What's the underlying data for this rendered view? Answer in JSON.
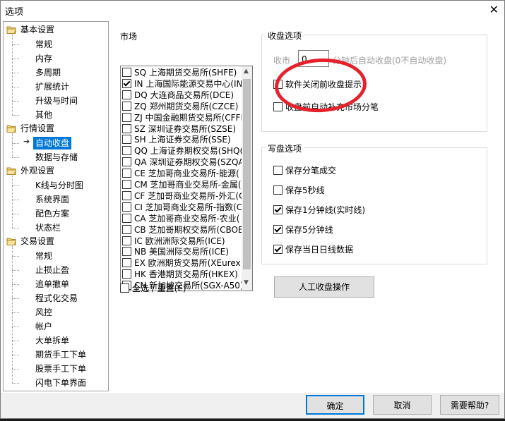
{
  "window": {
    "title": "选项",
    "close_glyph": "✕"
  },
  "tree": {
    "groups": [
      {
        "label": "基本设置",
        "items": [
          "常规",
          "内存",
          "多周期",
          "扩展统计",
          "升级与时间",
          "其他"
        ]
      },
      {
        "label": "行情设置",
        "items": [
          "自动收盘",
          "数据与存储"
        ],
        "selected": "自动收盘"
      },
      {
        "label": "外观设置",
        "items": [
          "K线与分时图",
          "系统界面",
          "配色方案",
          "状态栏"
        ]
      },
      {
        "label": "交易设置",
        "items": [
          "常规",
          "止损止盈",
          "追单撤单",
          "程式化交易",
          "风控",
          "帐户",
          "大单拆单",
          "期货手工下单",
          "股票手工下单",
          "闪电下单界面"
        ]
      }
    ]
  },
  "market": {
    "label": "市场",
    "items": [
      {
        "text": "SQ 上海期货交易所(SHFE)",
        "checked": false
      },
      {
        "text": "IN 上海国际能源交易中心(IN",
        "checked": true
      },
      {
        "text": "DQ 大连商品交易所(DCE)",
        "checked": false
      },
      {
        "text": "ZQ 郑州期货交易所(CZCE)",
        "checked": false
      },
      {
        "text": "ZJ 中国金融期货交易所(CFFE",
        "checked": false
      },
      {
        "text": "SZ 深圳证券交易所(SZSE)",
        "checked": false
      },
      {
        "text": "SH 上海证券交易所(SSE)",
        "checked": false
      },
      {
        "text": "QQ 上海证券期权交易(SHQ(",
        "checked": false
      },
      {
        "text": "QA 深圳证券期权交易(SZQA",
        "checked": false
      },
      {
        "text": "CE 芝加哥商业交易所-能源(",
        "checked": false
      },
      {
        "text": "CM 芝加哥商业交易所-金属(",
        "checked": false
      },
      {
        "text": "CF 芝加哥商业交易所-外汇(C",
        "checked": false
      },
      {
        "text": "CI 芝加哥商业交易所-指数(C",
        "checked": false
      },
      {
        "text": "CA 芝加哥商业交易所-农业(",
        "checked": false
      },
      {
        "text": "CB 芝加哥期权交易所(CBOE",
        "checked": false
      },
      {
        "text": "IC 欧洲洲际交易所(ICE)",
        "checked": false
      },
      {
        "text": "NB 美国洲际交易所(ICE)",
        "checked": false
      },
      {
        "text": "EX 欧洲期货交易所(XEurex)",
        "checked": false
      },
      {
        "text": "HK 香港期货交易所(HKEX)",
        "checked": false
      },
      {
        "text": "CN 新加坡交易所(SGX-A50)",
        "checked": false
      }
    ],
    "select_all": "全选 / 重置(E)",
    "scroll_up": "▲",
    "scroll_down": "▼"
  },
  "close_options": {
    "label": "收盘选项",
    "prefix": "收市",
    "minutes_value": "0",
    "suffix": "分钟后自动收盘(0不自动收盘)",
    "items": [
      {
        "text": "软件关闭前收盘提示",
        "checked": false
      },
      {
        "text": "收盘前自动补充市场分笔",
        "checked": false
      }
    ]
  },
  "write_options": {
    "label": "写盘选项",
    "items": [
      {
        "text": "保存分笔成交",
        "checked": false
      },
      {
        "text": "保存5秒线",
        "checked": false
      },
      {
        "text": "保存1分钟线(实时线)",
        "checked": true
      },
      {
        "text": "保存5分钟线",
        "checked": true
      },
      {
        "text": "保存当日日线数据",
        "checked": true
      }
    ]
  },
  "manual_close_button": "人工收盘操作",
  "footer": {
    "ok": "确定",
    "cancel": "取消",
    "help": "需要帮助?"
  },
  "colors": {
    "accent": "#0078d7",
    "annotation": "#e5222b"
  }
}
